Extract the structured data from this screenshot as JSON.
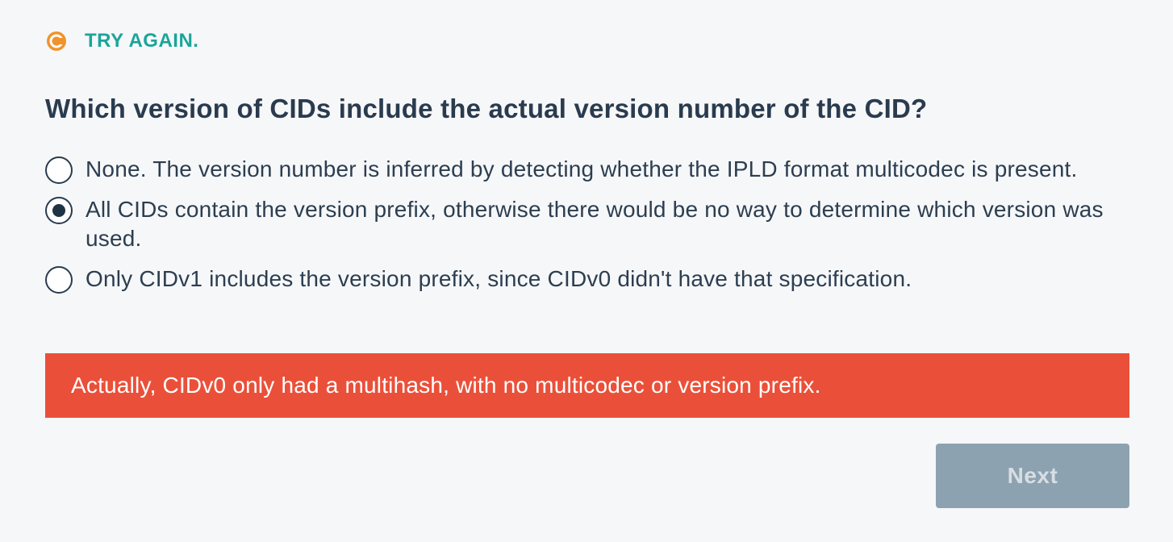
{
  "status": {
    "text": "TRY AGAIN.",
    "icon": "retry-icon",
    "icon_color": "#f0932b",
    "text_color": "#1aa59a"
  },
  "question": {
    "text": "Which version of CIDs include the actual version number of the CID?"
  },
  "options": [
    {
      "label": "None. The version number is inferred by detecting whether the IPLD format multicodec is present.",
      "selected": false
    },
    {
      "label": "All CIDs contain the version prefix, otherwise there would be no way to determine which version was used.",
      "selected": true
    },
    {
      "label": "Only CIDv1 includes the version prefix, since CIDv0 didn't have that specification.",
      "selected": false
    }
  ],
  "feedback": {
    "text": "Actually, CIDv0 only had a multihash, with no multicodec or version prefix.",
    "color": "#ea5039"
  },
  "next_button": {
    "label": "Next",
    "enabled": false
  }
}
